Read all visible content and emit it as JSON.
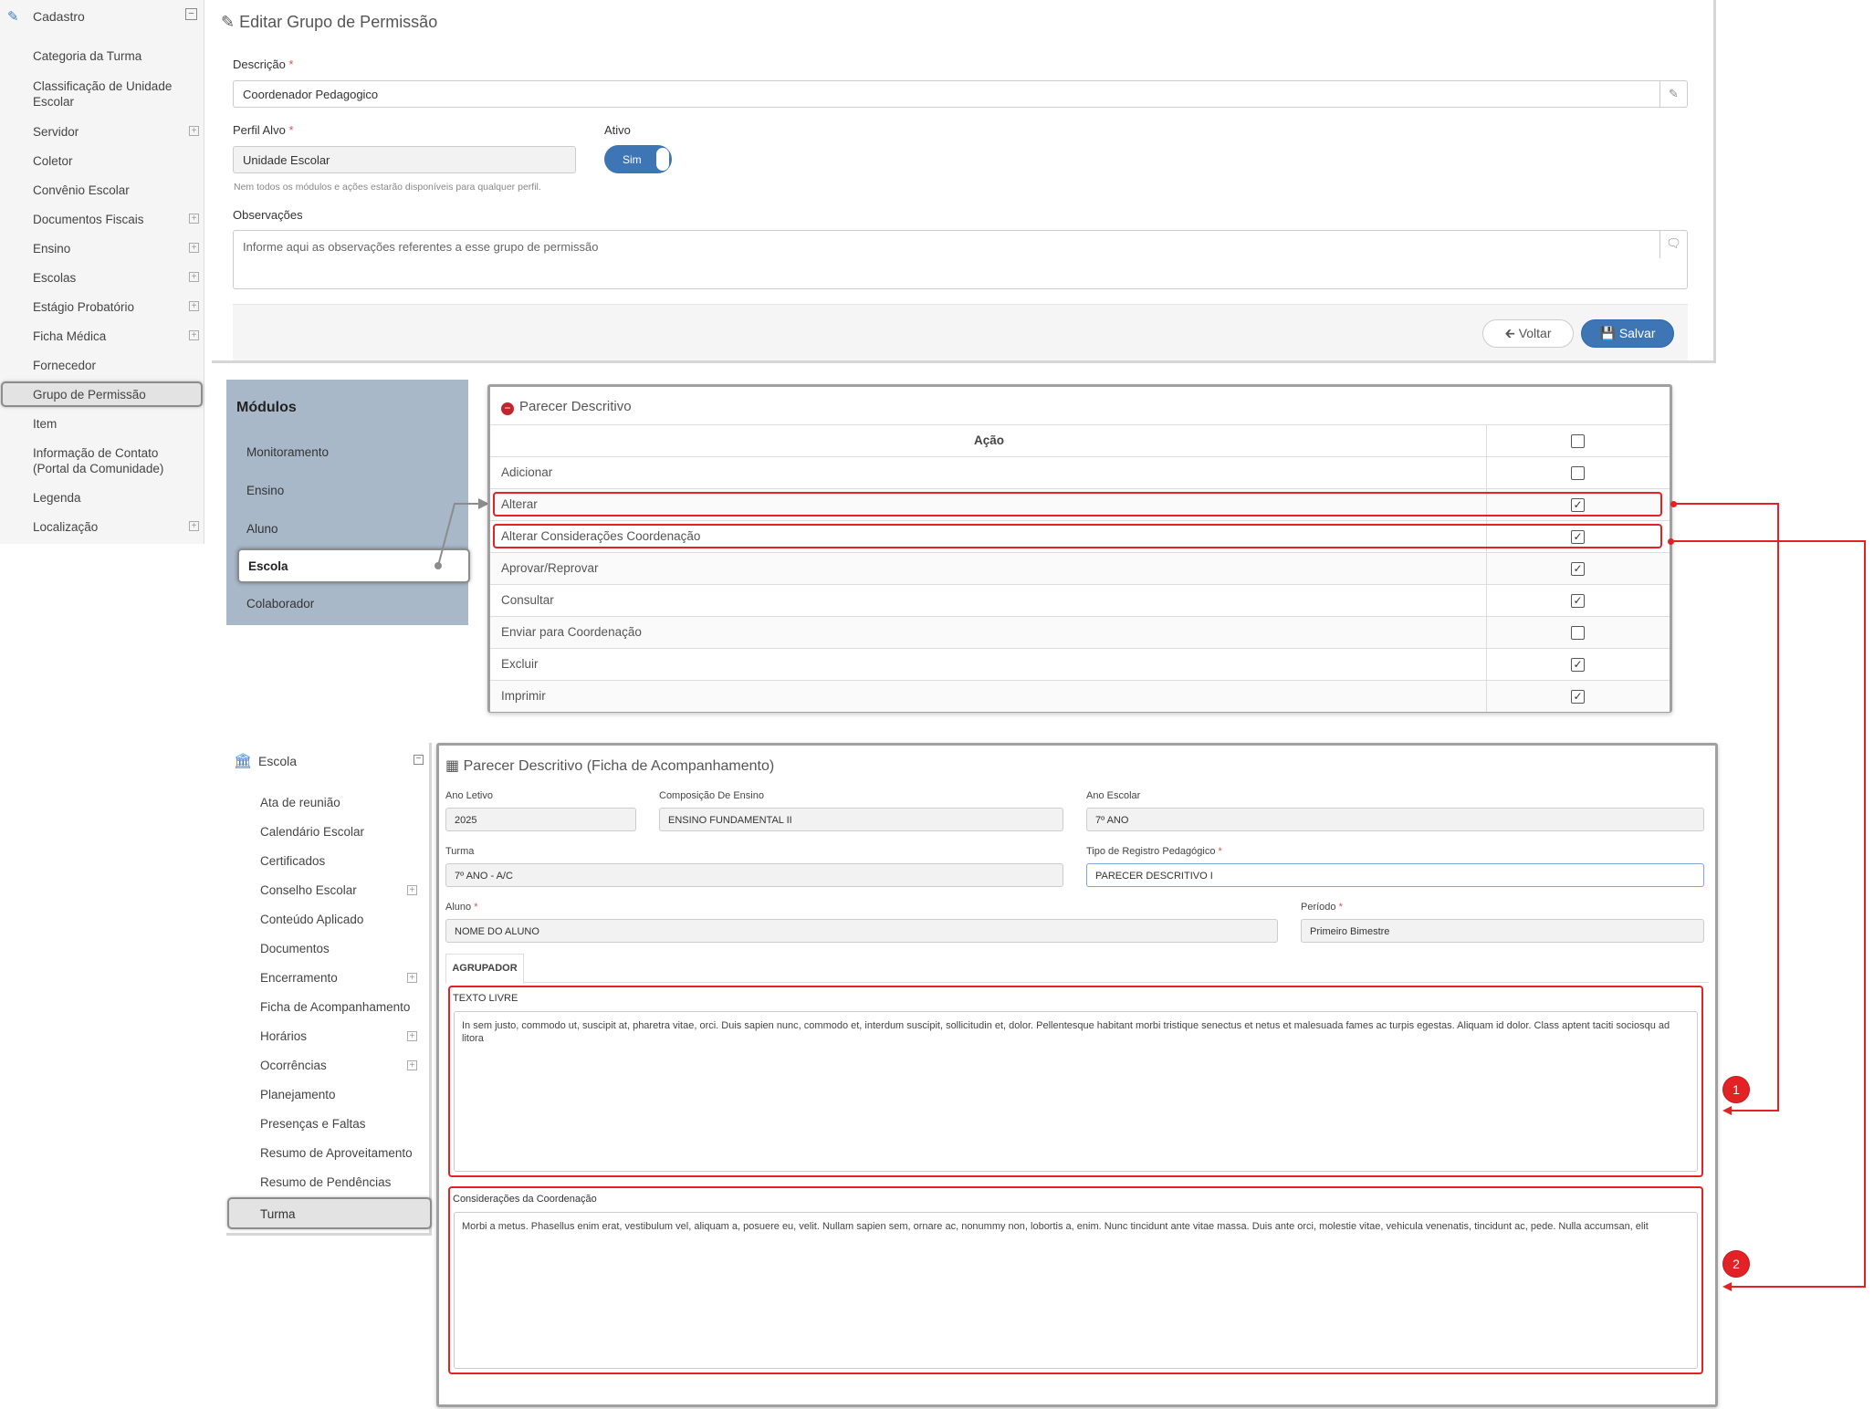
{
  "sidebar_cadastro": {
    "title": "Cadastro",
    "items": [
      {
        "label": "Categoria da Turma"
      },
      {
        "label": "Classificação de Unidade Escolar"
      },
      {
        "label": "Servidor"
      },
      {
        "label": "Coletor"
      },
      {
        "label": "Convênio Escolar"
      },
      {
        "label": "Documentos Fiscais"
      },
      {
        "label": "Ensino"
      },
      {
        "label": "Escolas"
      },
      {
        "label": "Estágio Probatório"
      },
      {
        "label": "Ficha Médica"
      },
      {
        "label": "Fornecedor"
      },
      {
        "label": "Grupo de Permissão"
      },
      {
        "label": "Item"
      },
      {
        "label": "Informação de Contato (Portal da Comunidade)"
      },
      {
        "label": "Legenda"
      },
      {
        "label": "Localização"
      }
    ]
  },
  "form": {
    "title": "Editar Grupo de Permissão",
    "descricao_label": "Descrição",
    "descricao_value": "Coordenador Pedagogico",
    "perfil_label": "Perfil Alvo",
    "perfil_value": "Unidade Escolar",
    "ativo_label": "Ativo",
    "ativo_value": "Sim",
    "hint": "Nem todos os módulos e ações estarão disponíveis para qualquer perfil.",
    "obs_label": "Observações",
    "obs_placeholder": "Informe aqui as observações referentes a esse grupo de permissão",
    "voltar": "Voltar",
    "salvar": "Salvar",
    "required_mark": "*"
  },
  "modules": {
    "title": "Módulos",
    "items": [
      {
        "label": "Monitoramento"
      },
      {
        "label": "Ensino"
      },
      {
        "label": "Aluno"
      },
      {
        "label": "Escola"
      },
      {
        "label": "Colaborador"
      }
    ]
  },
  "permissions": {
    "title": "Parecer Descritivo",
    "header": "Ação",
    "rows": [
      {
        "label": "Adicionar",
        "checked": false
      },
      {
        "label": "Alterar",
        "checked": true
      },
      {
        "label": "Alterar Considerações Coordenação",
        "checked": true
      },
      {
        "label": "Aprovar/Reprovar",
        "checked": true
      },
      {
        "label": "Consultar",
        "checked": true
      },
      {
        "label": "Enviar para Coordenação",
        "checked": false
      },
      {
        "label": "Excluir",
        "checked": true
      },
      {
        "label": "Imprimir",
        "checked": true
      }
    ]
  },
  "sidebar_escola": {
    "title": "Escola",
    "items": [
      {
        "label": "Ata de reunião"
      },
      {
        "label": "Calendário Escolar"
      },
      {
        "label": "Certificados"
      },
      {
        "label": "Conselho Escolar"
      },
      {
        "label": "Conteúdo Aplicado"
      },
      {
        "label": "Documentos"
      },
      {
        "label": "Encerramento"
      },
      {
        "label": "Ficha de Acompanhamento"
      },
      {
        "label": "Horários"
      },
      {
        "label": "Ocorrências"
      },
      {
        "label": "Planejamento"
      },
      {
        "label": "Presenças e Faltas"
      },
      {
        "label": "Resumo de Aproveitamento"
      },
      {
        "label": "Resumo de Pendências"
      },
      {
        "label": "Turma"
      }
    ]
  },
  "ficha": {
    "title": "Parecer Descritivo (Ficha de Acompanhamento)",
    "ano_letivo_label": "Ano Letivo",
    "ano_letivo_value": "2025",
    "composicao_label": "Composição De Ensino",
    "composicao_value": "ENSINO FUNDAMENTAL II",
    "ano_escolar_label": "Ano Escolar",
    "ano_escolar_value": "7º ANO",
    "turma_label": "Turma",
    "turma_value": "7º ANO - A/C",
    "tipo_label": "Tipo de Registro Pedagógico",
    "tipo_value": "PARECER DESCRITIVO I",
    "aluno_label": "Aluno",
    "aluno_value": "NOME DO ALUNO",
    "periodo_label": "Período",
    "periodo_value": "Primeiro Bimestre",
    "tab": "AGRUPADOR",
    "texto_livre_label": "TEXTO LIVRE",
    "texto_livre_value": "In sem justo, commodo ut, suscipit at, pharetra vitae, orci. Duis sapien nunc, commodo et, interdum suscipit, sollicitudin et, dolor. Pellentesque habitant morbi tristique senectus et netus et malesuada fames ac turpis egestas. Aliquam id dolor. Class aptent taciti sociosqu ad litora",
    "consideracoes_label": "Considerações da Coordenação",
    "consideracoes_value": "Morbi a metus. Phasellus enim erat, vestibulum vel, aliquam a, posuere eu, velit. Nullam sapien sem, ornare ac, nonummy non, lobortis a, enim. Nunc tincidunt ante vitae massa. Duis ante orci, molestie vitae, vehicula venenatis, tincidunt ac, pede. Nulla accumsan, elit"
  },
  "markers": [
    "1",
    "2"
  ],
  "colors": {
    "accent": "#3d75b5",
    "highlight": "#e32226",
    "modules_bg": "#a8b8c9"
  },
  "icons": [
    "edit-icon",
    "minus-circle-icon",
    "bank-icon",
    "table-icon",
    "pencil-icon",
    "comment-icon",
    "arrow-left-icon",
    "save-icon",
    "check-icon"
  ]
}
